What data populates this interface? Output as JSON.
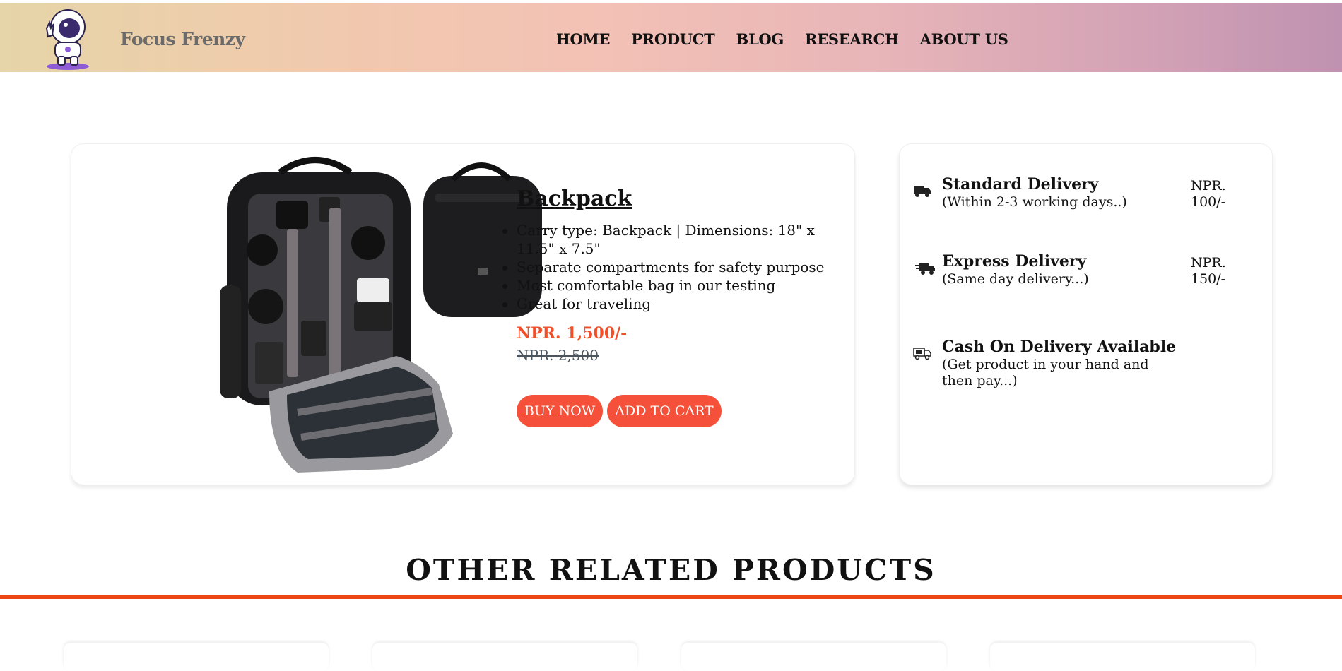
{
  "header": {
    "brand": "Focus Frenzy",
    "logo_icon": "astronaut-logo-icon",
    "nav": [
      "HOME",
      "PRODUCT",
      "BLOG",
      "RESEARCH",
      "ABOUT US"
    ]
  },
  "product": {
    "title": "Backpack",
    "features": [
      "Carry type: Backpack | Dimensions: 18\" x 11.5\" x 7.5\"",
      "Separate compartments for safety purpose",
      "Most comfortable bag in our testing",
      "Great for traveling"
    ],
    "price": "NPR. 1,500/-",
    "old_price": "NPR. 2,500",
    "buy_label": "BUY NOW",
    "cart_label": "ADD TO CART"
  },
  "delivery": [
    {
      "icon": "delivery-truck-icon",
      "title": "Standard Delivery",
      "sub": "(Within 2-3 working days..)",
      "price": "NPR. 100/-"
    },
    {
      "icon": "express-truck-icon",
      "title": "Express Delivery",
      "sub": "(Same day delivery...)",
      "price": "NPR. 150/-"
    },
    {
      "icon": "cod-truck-icon",
      "title": "Cash On Delivery Available",
      "sub": "(Get product in your hand and then pay...)",
      "price": ""
    }
  ],
  "related": {
    "title": "OTHER RELATED PRODUCTS"
  },
  "colors": {
    "accent": "#f5513a",
    "price": "#f14f2a",
    "divider": "#ee4612"
  }
}
